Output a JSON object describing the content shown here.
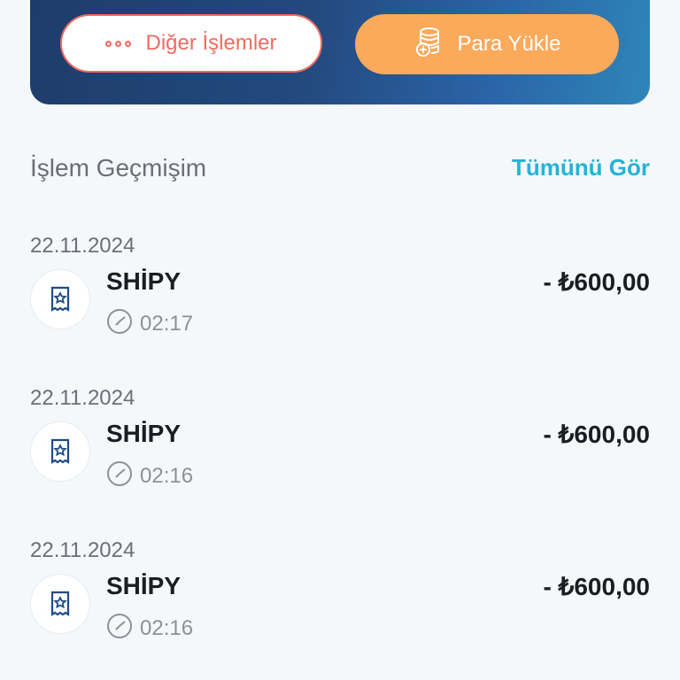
{
  "header": {
    "other_actions_label": "Diğer İşlemler",
    "load_money_label": "Para Yükle"
  },
  "history": {
    "title": "İşlem Geçmişim",
    "see_all_label": "Tümünü Gör",
    "transactions": [
      {
        "date": "22.11.2024",
        "merchant": "SHİPY",
        "time": "02:17",
        "amount": "- ₺600,00"
      },
      {
        "date": "22.11.2024",
        "merchant": "SHİPY",
        "time": "02:16",
        "amount": "- ₺600,00"
      },
      {
        "date": "22.11.2024",
        "merchant": "SHİPY",
        "time": "02:16",
        "amount": "- ₺600,00"
      }
    ]
  },
  "icons": {
    "other_actions": "dots-icon",
    "load_money": "coins-plus-icon",
    "transaction": "receipt-star-icon",
    "time": "clock-icon"
  },
  "colors": {
    "card_gradient_start": "#1d3c6b",
    "card_gradient_end": "#2e86b8",
    "other_actions_accent": "#ef6b5f",
    "load_money_bg": "#fba95a",
    "link": "#25b3d6",
    "icon_blue": "#1f4c86"
  }
}
